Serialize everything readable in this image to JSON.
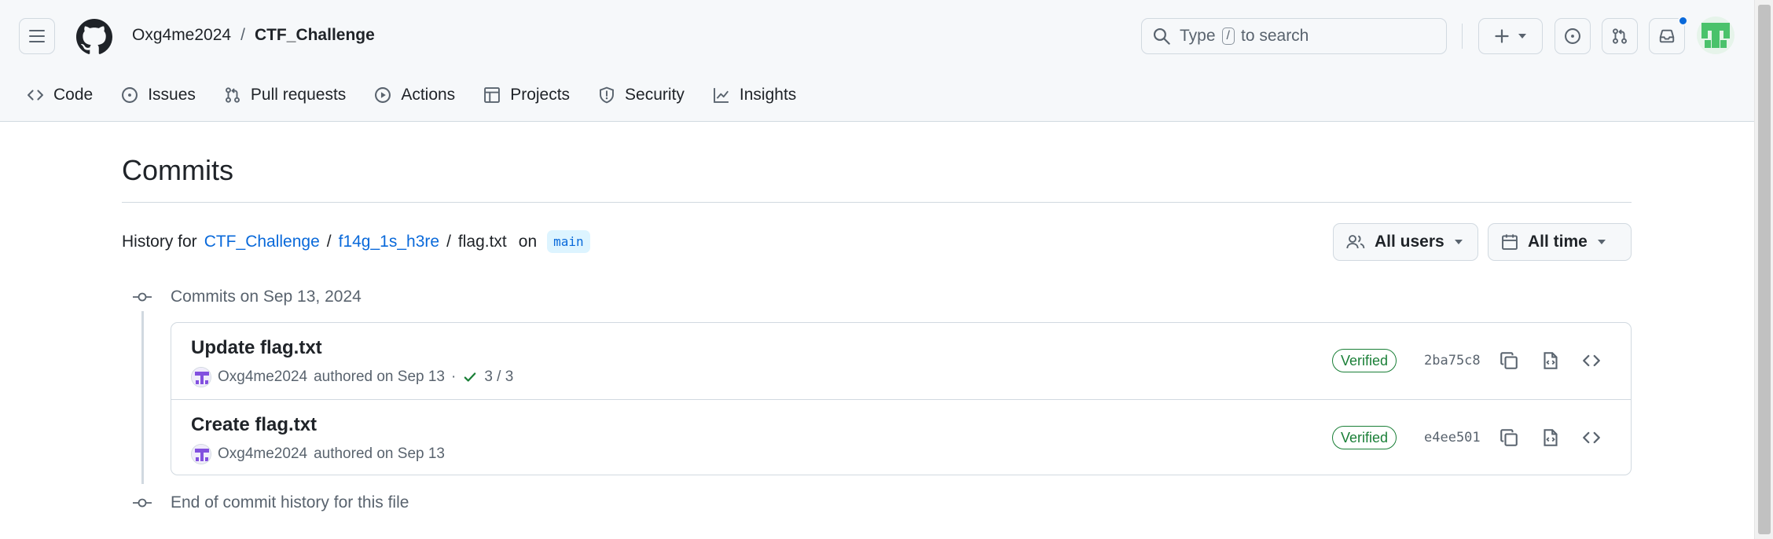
{
  "header": {
    "owner": "Oxg4me2024",
    "separator": "/",
    "repo": "CTF_Challenge",
    "search_prefix": "Type",
    "search_key": "/",
    "search_suffix": "to search"
  },
  "nav": {
    "items": [
      {
        "label": "Code",
        "icon": "code-icon"
      },
      {
        "label": "Issues",
        "icon": "issue-opened-icon"
      },
      {
        "label": "Pull requests",
        "icon": "git-pull-request-icon"
      },
      {
        "label": "Actions",
        "icon": "play-icon"
      },
      {
        "label": "Projects",
        "icon": "table-icon"
      },
      {
        "label": "Security",
        "icon": "shield-icon"
      },
      {
        "label": "Insights",
        "icon": "graph-icon"
      }
    ]
  },
  "page": {
    "title": "Commits",
    "history_prefix": "History for",
    "path": [
      "CTF_Challenge",
      "f14g_1s_h3re"
    ],
    "path_sep": "/",
    "file": "flag.txt",
    "on": "on",
    "branch": "main"
  },
  "filters": {
    "users": "All users",
    "time": "All time"
  },
  "timeline": {
    "group_label": "Commits on Sep 13, 2024",
    "end_label": "End of commit history for this file"
  },
  "commits": [
    {
      "title": "Update flag.txt",
      "author": "Oxg4me2024",
      "authored": "authored on Sep 13",
      "dot": "·",
      "checks": "3 / 3",
      "badge": "Verified",
      "sha": "2ba75c8"
    },
    {
      "title": "Create flag.txt",
      "author": "Oxg4me2024",
      "authored": "authored on Sep 13",
      "badge": "Verified",
      "sha": "e4ee501"
    }
  ],
  "colors": {
    "accent": "#0969da",
    "success": "#1a7f37",
    "avatar_green": "#4ac26b"
  }
}
